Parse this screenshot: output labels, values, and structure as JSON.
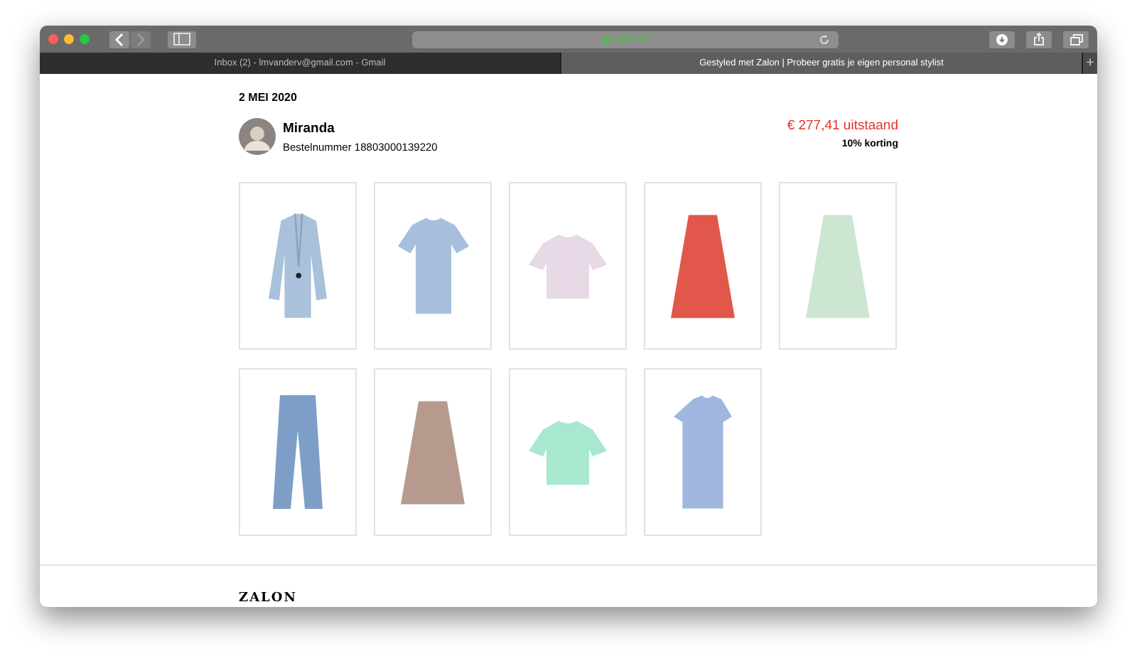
{
  "browser": {
    "address": "zalon.nl",
    "tabs": [
      {
        "label": "Inbox (2) - lmvanderv@gmail.com - Gmail",
        "selected": false
      },
      {
        "label": "Gestyled met Zalon | Probeer gratis je eigen personal stylist",
        "selected": true
      }
    ],
    "new_tab": "+"
  },
  "order": {
    "date": "2 MEI 2020",
    "stylist": "Miranda",
    "order_number": "Bestelnummer 18803000139220",
    "amount": "€ 277,41 uitstaand",
    "discount": "10% korting"
  },
  "products": [
    {
      "kind": "blazer",
      "color": "#a9c1da"
    },
    {
      "kind": "tshirt",
      "color": "#a7bfdc"
    },
    {
      "kind": "croptee",
      "color": "#e8d9e6"
    },
    {
      "kind": "skirt",
      "color": "#e2574c"
    },
    {
      "kind": "skirt",
      "color": "#cde6d2"
    },
    {
      "kind": "jeans",
      "color": "#7d9fc7"
    },
    {
      "kind": "skirt",
      "color": "#b79a8e"
    },
    {
      "kind": "croptee",
      "color": "#a8e8cf"
    },
    {
      "kind": "dress",
      "color": "#9fb7de"
    }
  ],
  "footer": {
    "logo": "ZALON"
  }
}
